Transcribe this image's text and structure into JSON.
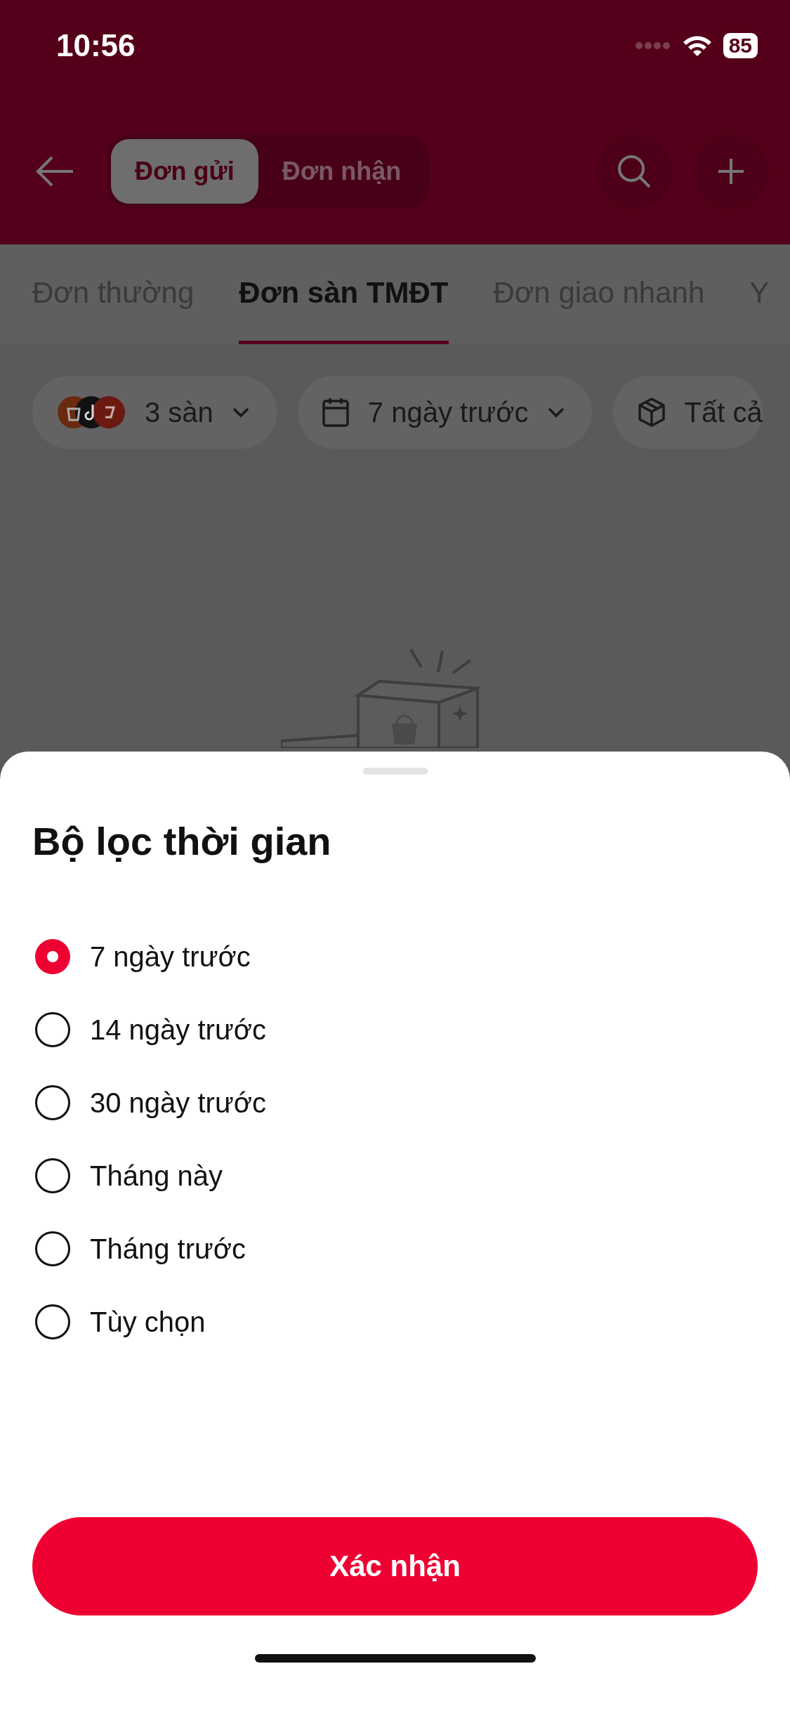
{
  "status_bar": {
    "time": "10:56",
    "battery": "85"
  },
  "header": {
    "segments": [
      {
        "label": "Đơn gửi",
        "selected": true
      },
      {
        "label": "Đơn nhận",
        "selected": false
      }
    ]
  },
  "tabs": [
    {
      "label": "Đơn thường",
      "selected": false
    },
    {
      "label": "Đơn sàn TMĐT",
      "selected": true
    },
    {
      "label": "Đơn giao nhanh",
      "selected": false
    },
    {
      "label": "Y",
      "selected": false
    }
  ],
  "filters": [
    {
      "kind": "platforms",
      "label": "3 sàn"
    },
    {
      "kind": "date",
      "label": "7 ngày trước"
    },
    {
      "kind": "package",
      "label": "Tất cả"
    }
  ],
  "sheet": {
    "title": "Bộ lọc thời gian",
    "options": [
      {
        "label": "7 ngày trước",
        "selected": true
      },
      {
        "label": "14 ngày trước",
        "selected": false
      },
      {
        "label": "30 ngày trước",
        "selected": false
      },
      {
        "label": "Tháng này",
        "selected": false
      },
      {
        "label": "Tháng trước",
        "selected": false
      },
      {
        "label": "Tùy chọn",
        "selected": false
      }
    ],
    "confirm": "Xác nhận"
  }
}
